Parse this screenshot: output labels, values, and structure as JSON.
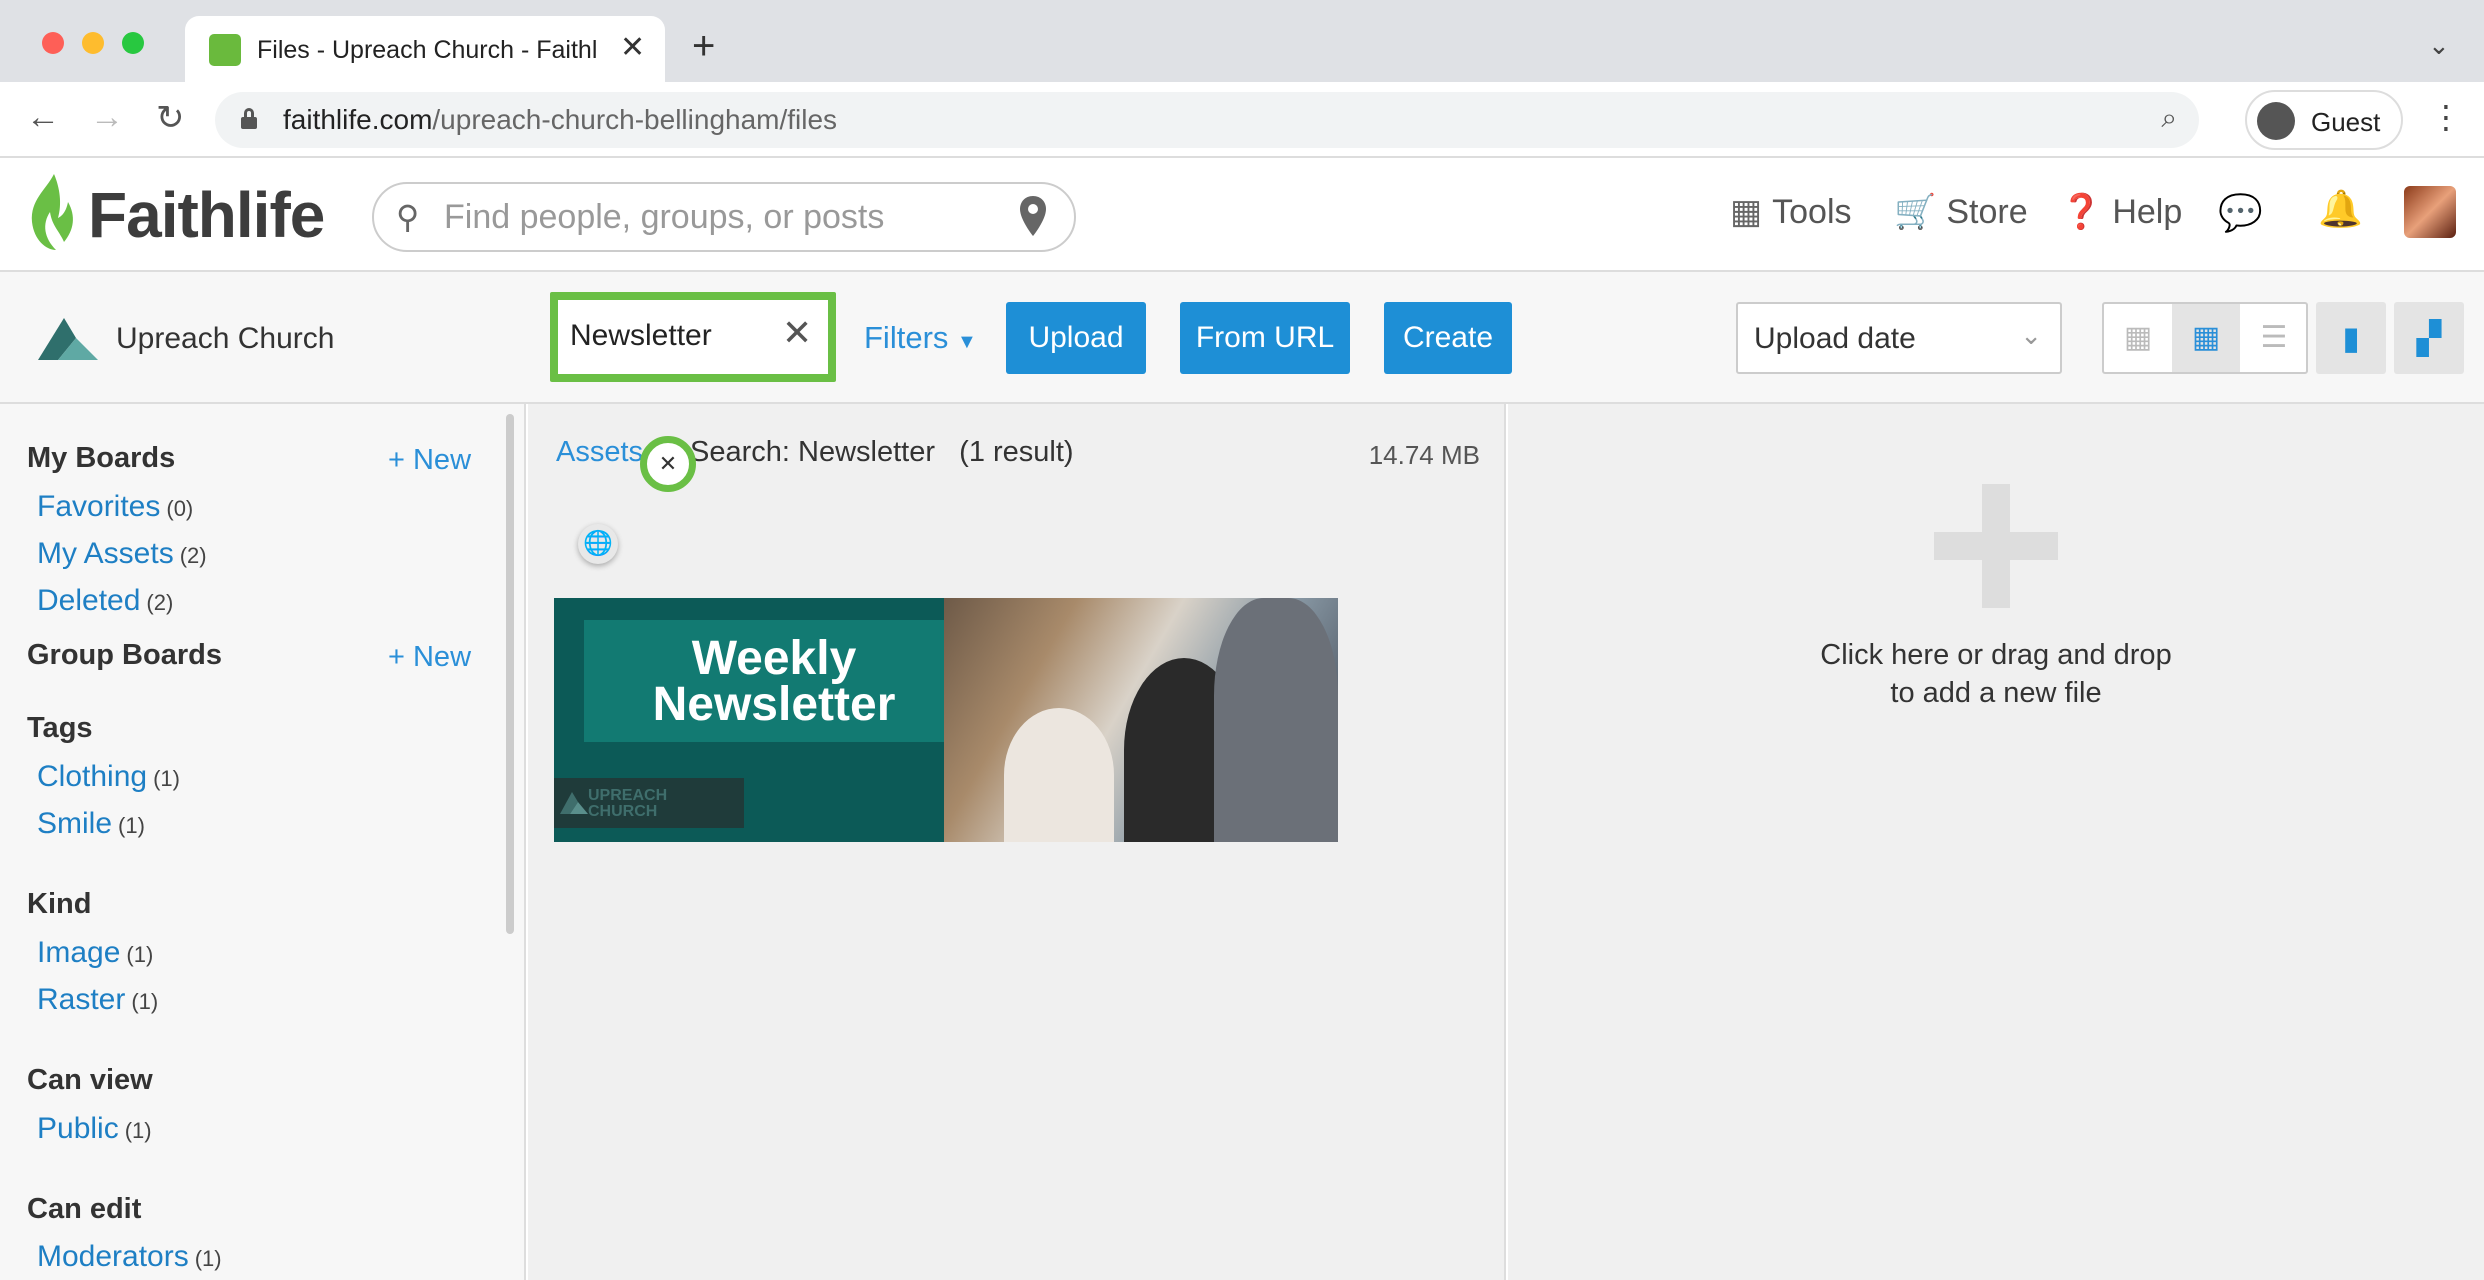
{
  "browser": {
    "tab_title": "Files - Upreach Church - Faithlife",
    "url_host": "faithlife.com",
    "url_path": "/upreach-church-bellingham/files",
    "profile_label": "Guest"
  },
  "header": {
    "logo_text": "Faithlife",
    "search_placeholder": "Find people, groups, or posts",
    "nav": {
      "tools": "Tools",
      "store": "Store",
      "help": "Help"
    }
  },
  "toolbar": {
    "group_name": "Upreach Church",
    "search_value": "Newsletter",
    "filters_label": "Filters",
    "upload_label": "Upload",
    "from_url_label": "From URL",
    "create_label": "Create",
    "sort_value": "Upload date"
  },
  "sidebar": {
    "my_boards": {
      "title": "My Boards",
      "new_label": "+ New",
      "items": [
        {
          "label": "Favorites",
          "count": "(0)"
        },
        {
          "label": "My Assets",
          "count": "(2)"
        },
        {
          "label": "Deleted",
          "count": "(2)"
        }
      ]
    },
    "group_boards": {
      "title": "Group Boards",
      "new_label": "+ New"
    },
    "tags": {
      "title": "Tags",
      "items": [
        {
          "label": "Clothing",
          "count": "(1)"
        },
        {
          "label": "Smile",
          "count": "(1)"
        }
      ]
    },
    "kind": {
      "title": "Kind",
      "items": [
        {
          "label": "Image",
          "count": "(1)"
        },
        {
          "label": "Raster",
          "count": "(1)"
        }
      ]
    },
    "can_view": {
      "title": "Can view",
      "items": [
        {
          "label": "Public",
          "count": "(1)"
        }
      ]
    },
    "can_edit": {
      "title": "Can edit",
      "items": [
        {
          "label": "Moderators",
          "count": "(1)"
        }
      ]
    }
  },
  "main": {
    "breadcrumb_assets": "Assets",
    "breadcrumb_search": "Search: Newsletter",
    "result_count": "(1 result)",
    "total_size": "14.74 MB",
    "thumbnail": {
      "title_line1": "Weekly",
      "title_line2": "Newsletter",
      "logo_line1": "UPREACH",
      "logo_line2": "CHURCH"
    }
  },
  "dropzone": {
    "line1": "Click here or drag and drop",
    "line2": "to add a new file"
  },
  "colors": {
    "brand_green": "#6abf45",
    "link_blue": "#2a8fd8",
    "button_blue": "#1e8fd6",
    "thumbnail_teal": "#0c5a57"
  }
}
